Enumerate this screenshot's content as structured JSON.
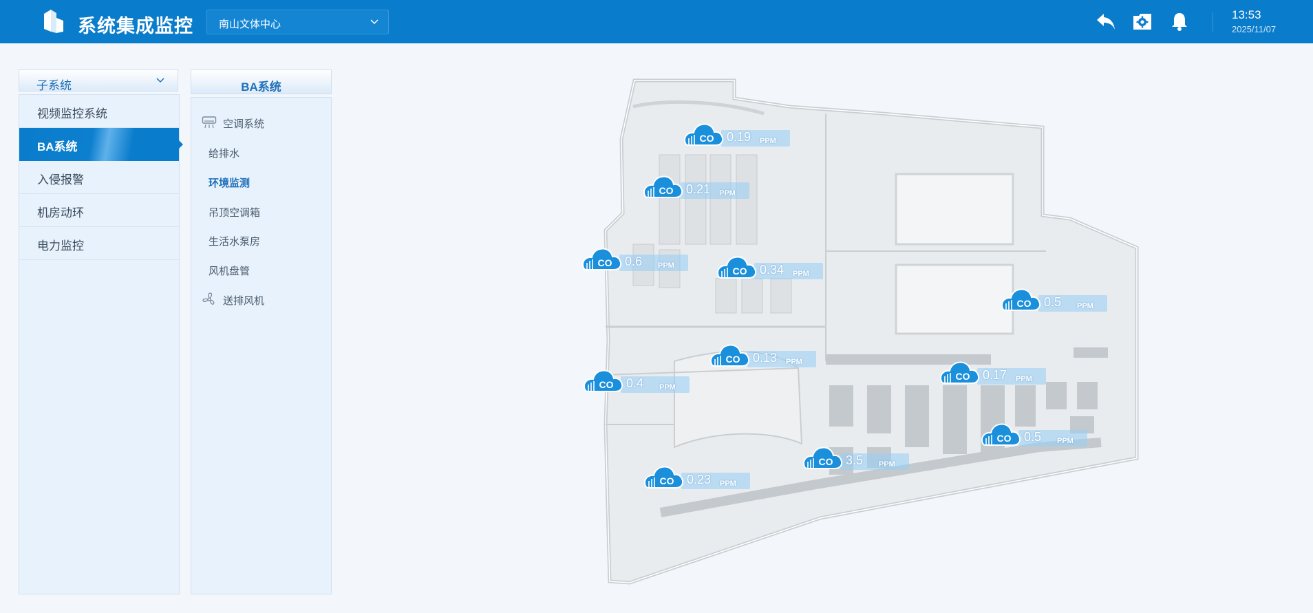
{
  "header": {
    "title": "系统集成监控",
    "site_select": "南山文体中心",
    "time": "13:53",
    "date": "2025/11/07",
    "icons": [
      "back-icon",
      "settings-icon",
      "bell-icon"
    ]
  },
  "subsystems": {
    "heading": "子系统",
    "items": [
      {
        "label": "视频监控系统"
      },
      {
        "label": "BA系统",
        "active": true
      },
      {
        "label": "入侵报警"
      },
      {
        "label": "机房动环"
      },
      {
        "label": "电力监控"
      }
    ]
  },
  "ba_panel": {
    "heading": "BA系统",
    "items": [
      {
        "label": "空调系统",
        "icon": "air-conditioner-icon"
      },
      {
        "label": "给排水"
      },
      {
        "label": "环境监测",
        "active": true
      },
      {
        "label": "吊顶空调箱"
      },
      {
        "label": "生活水泵房"
      },
      {
        "label": "风机盘管"
      },
      {
        "label": "送排风机",
        "icon": "fan-icon"
      }
    ]
  },
  "map": {
    "sensor_type": "CO",
    "sensors": [
      {
        "value": "0.19",
        "unit": "PPM"
      },
      {
        "value": "0.21",
        "unit": "PPM"
      },
      {
        "value": "0.6",
        "unit": "PPM"
      },
      {
        "value": "0.34",
        "unit": "PPM"
      },
      {
        "value": "0.5",
        "unit": "PPM"
      },
      {
        "value": "0.13",
        "unit": "PPM"
      },
      {
        "value": "0.4",
        "unit": "PPM"
      },
      {
        "value": "0.17",
        "unit": "PPM"
      },
      {
        "value": "0.5",
        "unit": "PPM"
      },
      {
        "value": "3.5",
        "unit": "PPM"
      },
      {
        "value": "0.23",
        "unit": "PPM"
      }
    ]
  },
  "colors": {
    "brand": "#0a7ccc",
    "panel_bg": "#e8f2fd",
    "sensor": "#1a8fdc"
  }
}
